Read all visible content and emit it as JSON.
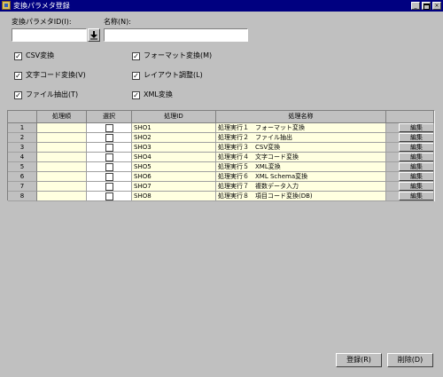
{
  "window": {
    "title": "変換パラメタ登録",
    "minimize": "_",
    "close": "×"
  },
  "form": {
    "param_id_label": "変換パラメタID(I):",
    "param_id_value": "",
    "dropdown_icon": "download-arrow-icon",
    "name_label": "名称(N):",
    "name_value": ""
  },
  "options": [
    {
      "label": "CSV変換",
      "checked": true
    },
    {
      "label": "フォーマット変換(M)",
      "checked": true
    },
    {
      "label": "文字コード変換(V)",
      "checked": true
    },
    {
      "label": "レイアウト調整(L)",
      "checked": true
    },
    {
      "label": "ファイル抽出(T)",
      "checked": true
    },
    {
      "label": "XML変換",
      "checked": true
    }
  ],
  "table": {
    "headers": [
      "",
      "処理順",
      "選択",
      "処理ID",
      "処理名称",
      ""
    ],
    "rows": [
      {
        "num": "1",
        "order": "",
        "selected": false,
        "id": "SHO1",
        "name": "処理実行１　フォーマット変換",
        "edit": "編集"
      },
      {
        "num": "2",
        "order": "",
        "selected": false,
        "id": "SHO2",
        "name": "処理実行２　ファイル抽出",
        "edit": "編集"
      },
      {
        "num": "3",
        "order": "",
        "selected": false,
        "id": "SHO3",
        "name": "処理実行３　CSV変換",
        "edit": "編集"
      },
      {
        "num": "4",
        "order": "",
        "selected": false,
        "id": "SHO4",
        "name": "処理実行４　文字コード変換",
        "edit": "編集"
      },
      {
        "num": "5",
        "order": "",
        "selected": false,
        "id": "SHO5",
        "name": "処理実行５　XML変換",
        "edit": "編集"
      },
      {
        "num": "6",
        "order": "",
        "selected": false,
        "id": "SHO6",
        "name": "処理実行６　XML Schema変換",
        "edit": "編集"
      },
      {
        "num": "7",
        "order": "",
        "selected": false,
        "id": "SHO7",
        "name": "処理実行７　複数データ入力",
        "edit": "編集"
      },
      {
        "num": "8",
        "order": "",
        "selected": false,
        "id": "SHO8",
        "name": "処理実行８　項目コード変換(DB)",
        "edit": "編集"
      }
    ]
  },
  "buttons": {
    "register": "登録(R)",
    "delete": "削除(D)"
  }
}
